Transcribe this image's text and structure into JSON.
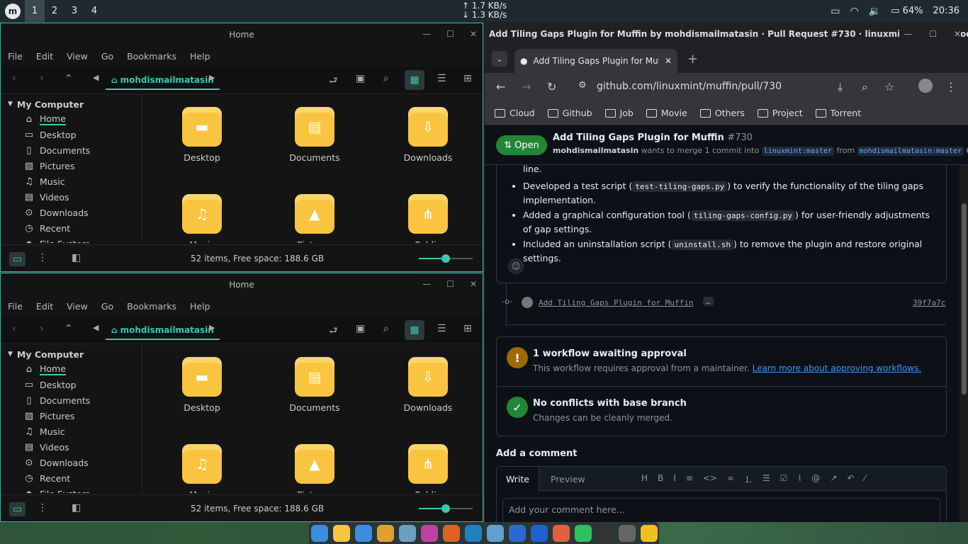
{
  "topbar": {
    "workspaces": [
      "1",
      "2",
      "3",
      "4"
    ],
    "net_up": "↑ 1.7 KB/s",
    "net_down": "↓ 1.3 KB/s",
    "battery": "64%",
    "clock": "20:36"
  },
  "fm": {
    "title": "Home",
    "menu": [
      "File",
      "Edit",
      "View",
      "Go",
      "Bookmarks",
      "Help"
    ],
    "crumb": "mohdismailmatasin",
    "sidebar_header": "My Computer",
    "sidebar": [
      {
        "label": "Home",
        "icon": "home-icon"
      },
      {
        "label": "Desktop",
        "icon": "desktop-icon"
      },
      {
        "label": "Documents",
        "icon": "document-icon"
      },
      {
        "label": "Pictures",
        "icon": "picture-icon"
      },
      {
        "label": "Music",
        "icon": "music-icon"
      },
      {
        "label": "Videos",
        "icon": "video-icon"
      },
      {
        "label": "Downloads",
        "icon": "download-icon"
      },
      {
        "label": "Recent",
        "icon": "clock-icon"
      },
      {
        "label": "File System",
        "icon": "drive-icon"
      }
    ],
    "folders": [
      "Desktop",
      "Documents",
      "Downloads",
      "Music",
      "Pictures",
      "Public"
    ],
    "status": "52 items, Free space: 188.6 GB",
    "zoom_level": 0.5
  },
  "chrome": {
    "window_title": "Add Tiling Gaps Plugin for Muffin by mohdismailmatasin · Pull Request #730 · linuxmint/muffin - Google Ch...",
    "tab_title": "Add Tiling Gaps Plugin for Muffin",
    "url": "github.com/linuxmint/muffin/pull/730",
    "bookmarks": [
      "Cloud",
      "Github",
      "Job",
      "Movie",
      "Others",
      "Project",
      "Torrent"
    ]
  },
  "pr": {
    "state": "Open",
    "title": "Add Tiling Gaps Plugin for Muffin",
    "number": "#730",
    "author": "mohdismailmatasin",
    "merge_text": "wants to merge 1 commit into",
    "base": "linuxmint:master",
    "from": "from",
    "head": "mohdismailmatasin:master",
    "line_prev": "line.",
    "bullets": [
      {
        "pre": "Developed a test script (",
        "code": "test-tiling-gaps.py",
        "post": ") to verify the functionality of the tiling gaps implementation."
      },
      {
        "pre": "Added a graphical configuration tool (",
        "code": "tiling-gaps-config.py",
        "post": ") for user-friendly adjustments of gap settings."
      },
      {
        "pre": "Included an uninstallation script (",
        "code": "uninstall.sh",
        "post": ") to remove the plugin and restore original settings."
      }
    ],
    "commit_msg": "Add Tiling Gaps Plugin for Muffin",
    "commit_more": "…",
    "commit_sha": "39f7a7c",
    "workflow_title": "1 workflow awaiting approval",
    "workflow_text": "This workflow requires approval from a maintainer.",
    "workflow_link": "Learn more about approving workflows.",
    "conflict_title": "No conflicts with base branch",
    "conflict_text": "Changes can be cleanly merged.",
    "comment_heading": "Add a comment",
    "tab_write": "Write",
    "tab_preview": "Preview",
    "comment_placeholder": "Add your comment here..."
  }
}
